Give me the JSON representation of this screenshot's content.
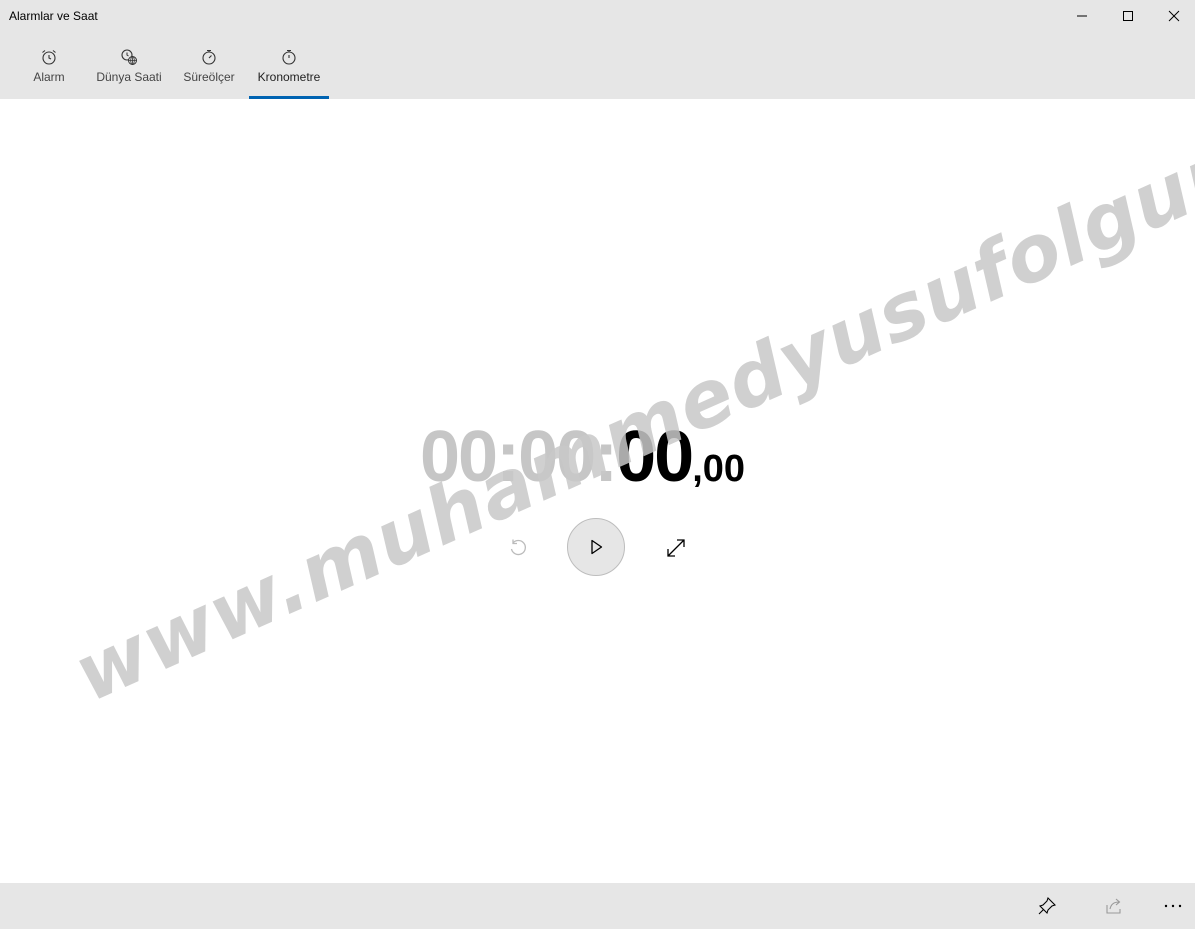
{
  "window": {
    "title": "Alarmlar ve Saat"
  },
  "tabs": [
    {
      "label": "Alarm",
      "icon": "alarm-clock-icon"
    },
    {
      "label": "Dünya Saati",
      "icon": "world-clock-icon"
    },
    {
      "label": "Süreölçer",
      "icon": "timer-icon"
    },
    {
      "label": "Kronometre",
      "icon": "stopwatch-icon",
      "active": true
    }
  ],
  "stopwatch": {
    "hours_minutes": "00:00:",
    "seconds": "00",
    "hundredths": ",00"
  },
  "watermark": "www.muhammedyusufolgun.blogspot.com",
  "colors": {
    "accent": "#0063b1",
    "chrome": "#e6e6e6",
    "dim_digits": "#c6c6c6"
  }
}
